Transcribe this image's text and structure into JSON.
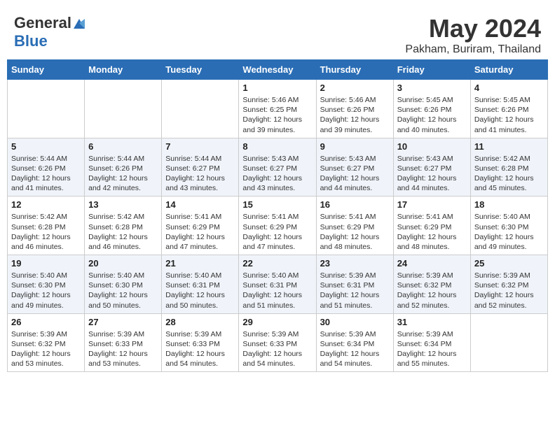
{
  "header": {
    "logo_general": "General",
    "logo_blue": "Blue",
    "title": "May 2024",
    "subtitle": "Pakham, Buriram, Thailand"
  },
  "days_of_week": [
    "Sunday",
    "Monday",
    "Tuesday",
    "Wednesday",
    "Thursday",
    "Friday",
    "Saturday"
  ],
  "weeks": [
    [
      {
        "day": "",
        "info": ""
      },
      {
        "day": "",
        "info": ""
      },
      {
        "day": "",
        "info": ""
      },
      {
        "day": "1",
        "info": "Sunrise: 5:46 AM\nSunset: 6:25 PM\nDaylight: 12 hours and 39 minutes."
      },
      {
        "day": "2",
        "info": "Sunrise: 5:46 AM\nSunset: 6:26 PM\nDaylight: 12 hours and 39 minutes."
      },
      {
        "day": "3",
        "info": "Sunrise: 5:45 AM\nSunset: 6:26 PM\nDaylight: 12 hours and 40 minutes."
      },
      {
        "day": "4",
        "info": "Sunrise: 5:45 AM\nSunset: 6:26 PM\nDaylight: 12 hours and 41 minutes."
      }
    ],
    [
      {
        "day": "5",
        "info": "Sunrise: 5:44 AM\nSunset: 6:26 PM\nDaylight: 12 hours and 41 minutes."
      },
      {
        "day": "6",
        "info": "Sunrise: 5:44 AM\nSunset: 6:26 PM\nDaylight: 12 hours and 42 minutes."
      },
      {
        "day": "7",
        "info": "Sunrise: 5:44 AM\nSunset: 6:27 PM\nDaylight: 12 hours and 43 minutes."
      },
      {
        "day": "8",
        "info": "Sunrise: 5:43 AM\nSunset: 6:27 PM\nDaylight: 12 hours and 43 minutes."
      },
      {
        "day": "9",
        "info": "Sunrise: 5:43 AM\nSunset: 6:27 PM\nDaylight: 12 hours and 44 minutes."
      },
      {
        "day": "10",
        "info": "Sunrise: 5:43 AM\nSunset: 6:27 PM\nDaylight: 12 hours and 44 minutes."
      },
      {
        "day": "11",
        "info": "Sunrise: 5:42 AM\nSunset: 6:28 PM\nDaylight: 12 hours and 45 minutes."
      }
    ],
    [
      {
        "day": "12",
        "info": "Sunrise: 5:42 AM\nSunset: 6:28 PM\nDaylight: 12 hours and 46 minutes."
      },
      {
        "day": "13",
        "info": "Sunrise: 5:42 AM\nSunset: 6:28 PM\nDaylight: 12 hours and 46 minutes."
      },
      {
        "day": "14",
        "info": "Sunrise: 5:41 AM\nSunset: 6:29 PM\nDaylight: 12 hours and 47 minutes."
      },
      {
        "day": "15",
        "info": "Sunrise: 5:41 AM\nSunset: 6:29 PM\nDaylight: 12 hours and 47 minutes."
      },
      {
        "day": "16",
        "info": "Sunrise: 5:41 AM\nSunset: 6:29 PM\nDaylight: 12 hours and 48 minutes."
      },
      {
        "day": "17",
        "info": "Sunrise: 5:41 AM\nSunset: 6:29 PM\nDaylight: 12 hours and 48 minutes."
      },
      {
        "day": "18",
        "info": "Sunrise: 5:40 AM\nSunset: 6:30 PM\nDaylight: 12 hours and 49 minutes."
      }
    ],
    [
      {
        "day": "19",
        "info": "Sunrise: 5:40 AM\nSunset: 6:30 PM\nDaylight: 12 hours and 49 minutes."
      },
      {
        "day": "20",
        "info": "Sunrise: 5:40 AM\nSunset: 6:30 PM\nDaylight: 12 hours and 50 minutes."
      },
      {
        "day": "21",
        "info": "Sunrise: 5:40 AM\nSunset: 6:31 PM\nDaylight: 12 hours and 50 minutes."
      },
      {
        "day": "22",
        "info": "Sunrise: 5:40 AM\nSunset: 6:31 PM\nDaylight: 12 hours and 51 minutes."
      },
      {
        "day": "23",
        "info": "Sunrise: 5:39 AM\nSunset: 6:31 PM\nDaylight: 12 hours and 51 minutes."
      },
      {
        "day": "24",
        "info": "Sunrise: 5:39 AM\nSunset: 6:32 PM\nDaylight: 12 hours and 52 minutes."
      },
      {
        "day": "25",
        "info": "Sunrise: 5:39 AM\nSunset: 6:32 PM\nDaylight: 12 hours and 52 minutes."
      }
    ],
    [
      {
        "day": "26",
        "info": "Sunrise: 5:39 AM\nSunset: 6:32 PM\nDaylight: 12 hours and 53 minutes."
      },
      {
        "day": "27",
        "info": "Sunrise: 5:39 AM\nSunset: 6:33 PM\nDaylight: 12 hours and 53 minutes."
      },
      {
        "day": "28",
        "info": "Sunrise: 5:39 AM\nSunset: 6:33 PM\nDaylight: 12 hours and 54 minutes."
      },
      {
        "day": "29",
        "info": "Sunrise: 5:39 AM\nSunset: 6:33 PM\nDaylight: 12 hours and 54 minutes."
      },
      {
        "day": "30",
        "info": "Sunrise: 5:39 AM\nSunset: 6:34 PM\nDaylight: 12 hours and 54 minutes."
      },
      {
        "day": "31",
        "info": "Sunrise: 5:39 AM\nSunset: 6:34 PM\nDaylight: 12 hours and 55 minutes."
      },
      {
        "day": "",
        "info": ""
      }
    ]
  ]
}
